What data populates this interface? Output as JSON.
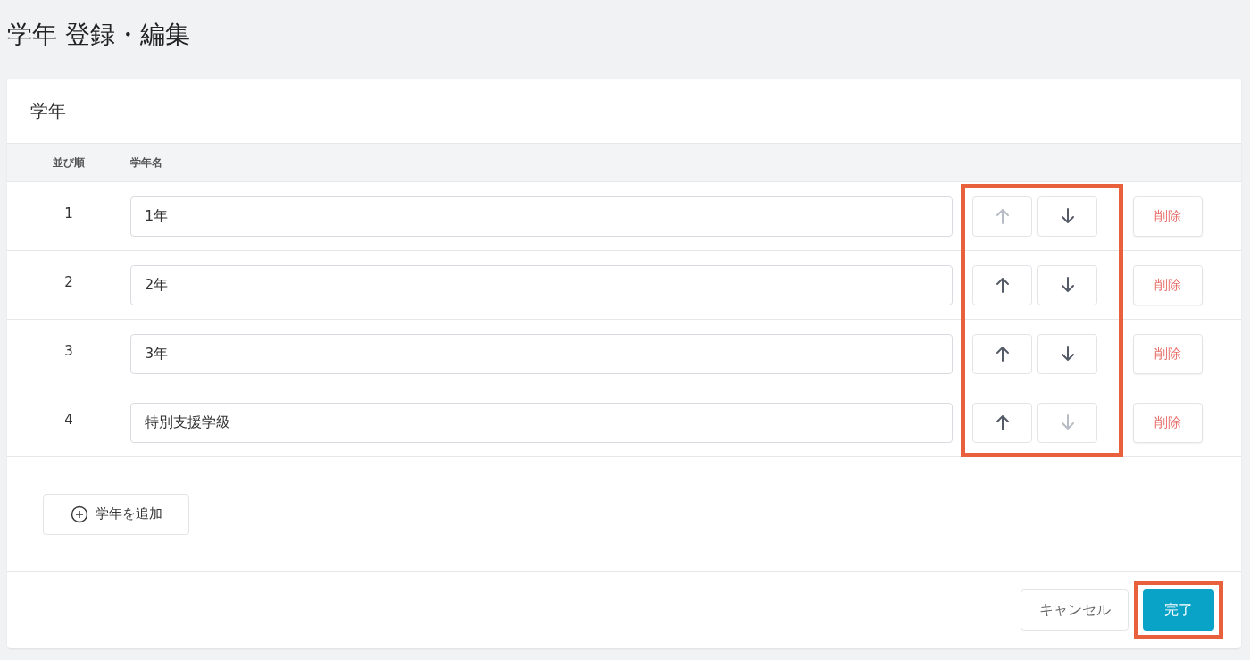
{
  "page_title": "学年 登録・編集",
  "card": {
    "title": "学年",
    "columns": [
      "並び順",
      "学年名"
    ],
    "arrows_highlighted": true,
    "rows": [
      {
        "order": "1",
        "name": "1年",
        "up_disabled": true,
        "down_disabled": false,
        "delete": "削除"
      },
      {
        "order": "2",
        "name": "2年",
        "up_disabled": false,
        "down_disabled": false,
        "delete": "削除"
      },
      {
        "order": "3",
        "name": "3年",
        "up_disabled": false,
        "down_disabled": false,
        "delete": "削除"
      },
      {
        "order": "4",
        "name": "特別支援学級",
        "up_disabled": false,
        "down_disabled": true,
        "delete": "削除"
      }
    ],
    "add_button": "学年を追加",
    "cancel_button": "キャンセル",
    "done_button": {
      "label": "完了",
      "highlighted": true
    }
  }
}
